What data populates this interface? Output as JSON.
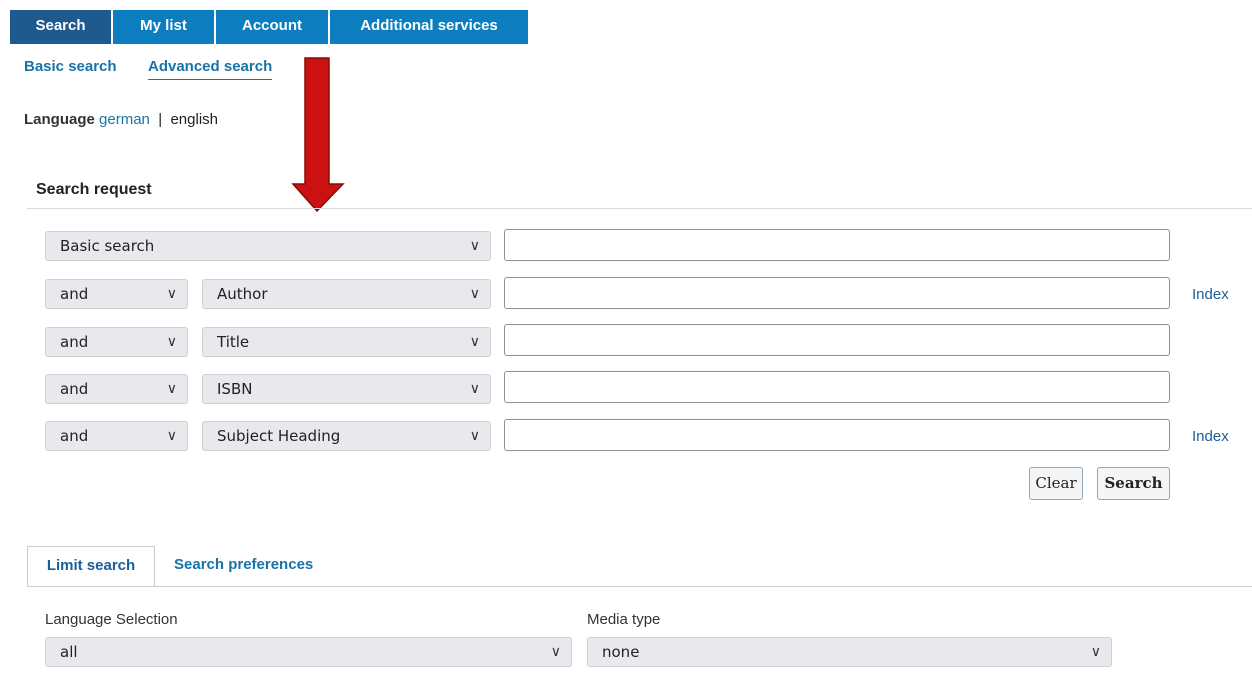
{
  "topnav": {
    "tabs": [
      "Search",
      "My list",
      "Account",
      "Additional services"
    ]
  },
  "subnav": {
    "basic": "Basic search",
    "advanced": "Advanced search"
  },
  "language": {
    "label": "Language",
    "german": "german",
    "separator": "|",
    "english": "english"
  },
  "search_request": {
    "heading": "Search request",
    "first_field": "Basic search",
    "rows": [
      {
        "operator": "and",
        "field": "Author",
        "index": "Index"
      },
      {
        "operator": "and",
        "field": "Title",
        "index": ""
      },
      {
        "operator": "and",
        "field": "ISBN",
        "index": ""
      },
      {
        "operator": "and",
        "field": "Subject Heading",
        "index": "Index"
      }
    ],
    "clear_label": "Clear",
    "search_label": "Search"
  },
  "limit": {
    "tab_limit": "Limit search",
    "tab_prefs": "Search preferences",
    "language_label": "Language Selection",
    "language_value": "all",
    "media_label": "Media type",
    "media_value": "none"
  },
  "colors": {
    "nav_active": "#1e5a8e",
    "nav": "#0c7ec0",
    "link": "#1a73a8",
    "arrow": "#cc1111"
  },
  "chevron_glyph": "∨"
}
